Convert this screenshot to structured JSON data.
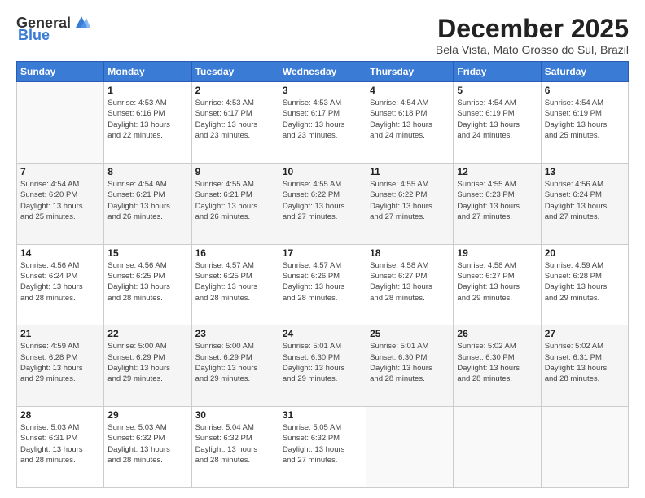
{
  "header": {
    "logo_general": "General",
    "logo_blue": "Blue",
    "title": "December 2025",
    "subtitle": "Bela Vista, Mato Grosso do Sul, Brazil"
  },
  "calendar": {
    "days_header": [
      "Sunday",
      "Monday",
      "Tuesday",
      "Wednesday",
      "Thursday",
      "Friday",
      "Saturday"
    ],
    "weeks": [
      [
        {
          "day": "",
          "info": ""
        },
        {
          "day": "1",
          "info": "Sunrise: 4:53 AM\nSunset: 6:16 PM\nDaylight: 13 hours\nand 22 minutes."
        },
        {
          "day": "2",
          "info": "Sunrise: 4:53 AM\nSunset: 6:17 PM\nDaylight: 13 hours\nand 23 minutes."
        },
        {
          "day": "3",
          "info": "Sunrise: 4:53 AM\nSunset: 6:17 PM\nDaylight: 13 hours\nand 23 minutes."
        },
        {
          "day": "4",
          "info": "Sunrise: 4:54 AM\nSunset: 6:18 PM\nDaylight: 13 hours\nand 24 minutes."
        },
        {
          "day": "5",
          "info": "Sunrise: 4:54 AM\nSunset: 6:19 PM\nDaylight: 13 hours\nand 24 minutes."
        },
        {
          "day": "6",
          "info": "Sunrise: 4:54 AM\nSunset: 6:19 PM\nDaylight: 13 hours\nand 25 minutes."
        }
      ],
      [
        {
          "day": "7",
          "info": "Sunrise: 4:54 AM\nSunset: 6:20 PM\nDaylight: 13 hours\nand 25 minutes."
        },
        {
          "day": "8",
          "info": "Sunrise: 4:54 AM\nSunset: 6:21 PM\nDaylight: 13 hours\nand 26 minutes."
        },
        {
          "day": "9",
          "info": "Sunrise: 4:55 AM\nSunset: 6:21 PM\nDaylight: 13 hours\nand 26 minutes."
        },
        {
          "day": "10",
          "info": "Sunrise: 4:55 AM\nSunset: 6:22 PM\nDaylight: 13 hours\nand 27 minutes."
        },
        {
          "day": "11",
          "info": "Sunrise: 4:55 AM\nSunset: 6:22 PM\nDaylight: 13 hours\nand 27 minutes."
        },
        {
          "day": "12",
          "info": "Sunrise: 4:55 AM\nSunset: 6:23 PM\nDaylight: 13 hours\nand 27 minutes."
        },
        {
          "day": "13",
          "info": "Sunrise: 4:56 AM\nSunset: 6:24 PM\nDaylight: 13 hours\nand 27 minutes."
        }
      ],
      [
        {
          "day": "14",
          "info": "Sunrise: 4:56 AM\nSunset: 6:24 PM\nDaylight: 13 hours\nand 28 minutes."
        },
        {
          "day": "15",
          "info": "Sunrise: 4:56 AM\nSunset: 6:25 PM\nDaylight: 13 hours\nand 28 minutes."
        },
        {
          "day": "16",
          "info": "Sunrise: 4:57 AM\nSunset: 6:25 PM\nDaylight: 13 hours\nand 28 minutes."
        },
        {
          "day": "17",
          "info": "Sunrise: 4:57 AM\nSunset: 6:26 PM\nDaylight: 13 hours\nand 28 minutes."
        },
        {
          "day": "18",
          "info": "Sunrise: 4:58 AM\nSunset: 6:27 PM\nDaylight: 13 hours\nand 28 minutes."
        },
        {
          "day": "19",
          "info": "Sunrise: 4:58 AM\nSunset: 6:27 PM\nDaylight: 13 hours\nand 29 minutes."
        },
        {
          "day": "20",
          "info": "Sunrise: 4:59 AM\nSunset: 6:28 PM\nDaylight: 13 hours\nand 29 minutes."
        }
      ],
      [
        {
          "day": "21",
          "info": "Sunrise: 4:59 AM\nSunset: 6:28 PM\nDaylight: 13 hours\nand 29 minutes."
        },
        {
          "day": "22",
          "info": "Sunrise: 5:00 AM\nSunset: 6:29 PM\nDaylight: 13 hours\nand 29 minutes."
        },
        {
          "day": "23",
          "info": "Sunrise: 5:00 AM\nSunset: 6:29 PM\nDaylight: 13 hours\nand 29 minutes."
        },
        {
          "day": "24",
          "info": "Sunrise: 5:01 AM\nSunset: 6:30 PM\nDaylight: 13 hours\nand 29 minutes."
        },
        {
          "day": "25",
          "info": "Sunrise: 5:01 AM\nSunset: 6:30 PM\nDaylight: 13 hours\nand 28 minutes."
        },
        {
          "day": "26",
          "info": "Sunrise: 5:02 AM\nSunset: 6:30 PM\nDaylight: 13 hours\nand 28 minutes."
        },
        {
          "day": "27",
          "info": "Sunrise: 5:02 AM\nSunset: 6:31 PM\nDaylight: 13 hours\nand 28 minutes."
        }
      ],
      [
        {
          "day": "28",
          "info": "Sunrise: 5:03 AM\nSunset: 6:31 PM\nDaylight: 13 hours\nand 28 minutes."
        },
        {
          "day": "29",
          "info": "Sunrise: 5:03 AM\nSunset: 6:32 PM\nDaylight: 13 hours\nand 28 minutes."
        },
        {
          "day": "30",
          "info": "Sunrise: 5:04 AM\nSunset: 6:32 PM\nDaylight: 13 hours\nand 28 minutes."
        },
        {
          "day": "31",
          "info": "Sunrise: 5:05 AM\nSunset: 6:32 PM\nDaylight: 13 hours\nand 27 minutes."
        },
        {
          "day": "",
          "info": ""
        },
        {
          "day": "",
          "info": ""
        },
        {
          "day": "",
          "info": ""
        }
      ]
    ]
  }
}
